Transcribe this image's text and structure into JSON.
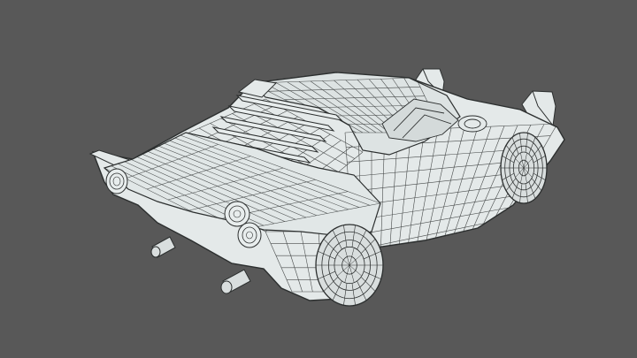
{
  "viewport": {
    "subject": "car-wireframe-model",
    "colors": {
      "background": "#585858",
      "surface": "#e4e9e9",
      "surface_shade": "#cfd6d6",
      "wire": "#2c2f2f",
      "tire": "#d9dede"
    }
  }
}
